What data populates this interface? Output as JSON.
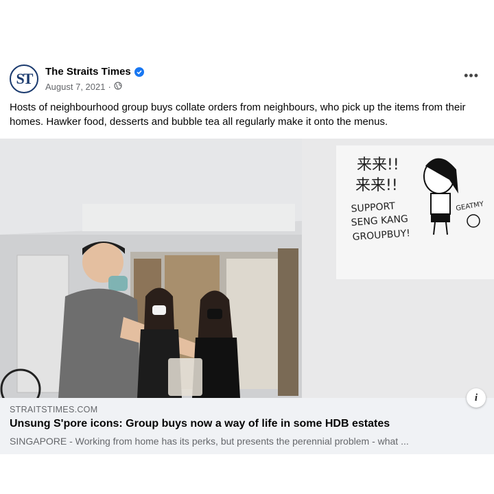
{
  "post": {
    "page_name": "The Straits Times",
    "logo_text": "ST",
    "date": "August 7, 2021",
    "date_separator": "·",
    "more_label": "•••",
    "caption": "Hosts of neighbourhood group buys collate orders from neighbours, who pick up the items from their homes. Hawker food, desserts and bubble tea all regularly make it onto the menus."
  },
  "photo": {
    "whiteboard_text": [
      "来来!!",
      "来来!!",
      "SUPPORT",
      "SENG KANG",
      "GROUPBUY!",
      "GEATMY"
    ]
  },
  "link": {
    "domain": "STRAITSTIMES.COM",
    "headline": "Unsung S'pore icons: Group buys now a way of life in some HDB estates",
    "description": "SINGAPORE - Working from home has its perks, but presents the perennial problem - what ...",
    "info_label": "i"
  },
  "colors": {
    "verified": "#1877f2",
    "logo": "#1a3a6e",
    "link_bg": "#f0f2f5"
  }
}
